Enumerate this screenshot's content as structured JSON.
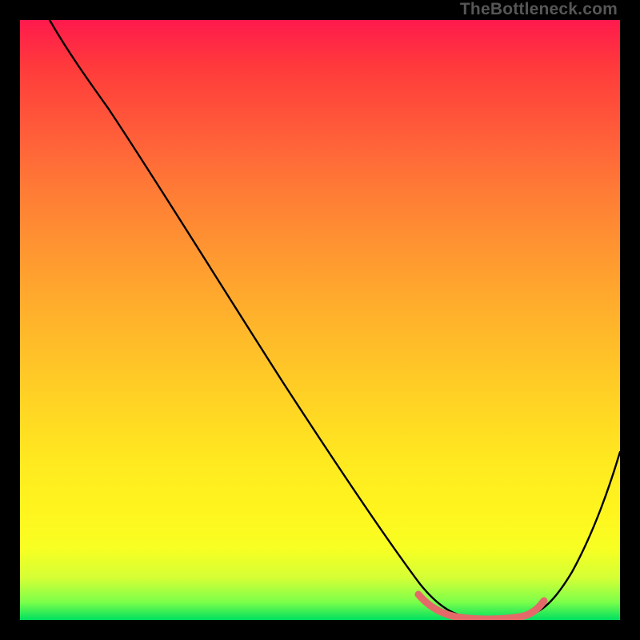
{
  "watermark": "TheBottleneck.com",
  "colors": {
    "frame": "#000000",
    "curve": "#000000",
    "highlight": "#e46a6a"
  },
  "chart_data": {
    "type": "line",
    "title": "",
    "xlabel": "",
    "ylabel": "",
    "xlim": [
      0,
      100
    ],
    "ylim": [
      0,
      100
    ],
    "grid": false,
    "legend": false,
    "notes": "Unlabeled axes; values are normalized 0–100 in each direction. Curve starts at top-left (~x=5, y≈100), descends with slight curvature to a broad flat minimum near y≈0 spanning roughly x=67–85, then rises to ~y≈40 at the right edge. A short coral segment highlights the flat minimum region.",
    "series": [
      {
        "name": "bottleneck-curve",
        "x": [
          5,
          10,
          18,
          26,
          34,
          42,
          50,
          58,
          64,
          68,
          72,
          76,
          80,
          84,
          88,
          92,
          96,
          100
        ],
        "y": [
          100,
          96,
          88,
          78,
          66,
          54,
          42,
          30,
          18,
          8,
          3,
          1,
          1,
          2,
          8,
          18,
          29,
          42
        ]
      },
      {
        "name": "highlight-minimum",
        "x": [
          67,
          70,
          73,
          76,
          79,
          82,
          85
        ],
        "y": [
          4,
          2,
          1,
          1,
          1,
          2,
          4
        ]
      }
    ]
  }
}
